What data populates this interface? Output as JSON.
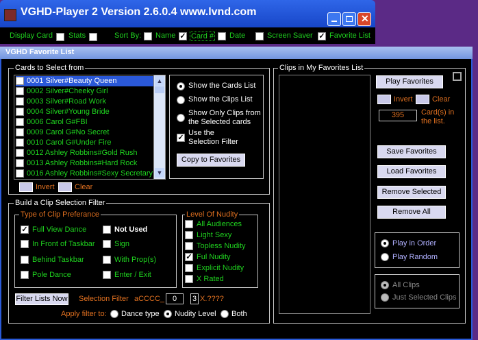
{
  "window": {
    "title": "VGHD-Player 2  Version 2.6.0.4  www.lvnd.com",
    "min_icon": "minimize-icon",
    "max_icon": "maximize-icon",
    "close_icon": "close-icon"
  },
  "toolbar": {
    "display_card": "Display Card",
    "stats": "Stats",
    "sort_by": "Sort By:",
    "name": "Name",
    "card_num": "Card #",
    "date": "Date",
    "screen_saver": "Screen Saver",
    "favorite_list": "Favorite List"
  },
  "fav_window": {
    "title": "VGHD Favorite List"
  },
  "cards": {
    "group_label": "Cards to Select from",
    "items": [
      "0001 Silver#Beauty Queen",
      "0002 Silver#Cheeky Girl",
      "0003 Silver#Road Work",
      "0004 Silver#Young Bride",
      "0006 Carol G#FBI",
      "0009 Carol G#No Secret",
      "0010 Carol G#Under Fire",
      "0012 Ashley Robbins#Gold Rush",
      "0013 Ashley Robbins#Hard Rock",
      "0016 Ashley Robbins#Sexy Secretary"
    ],
    "invert": "Invert",
    "clear": "Clear",
    "options": {
      "show_cards": "Show the Cards List",
      "show_clips": "Show the Clips List",
      "show_only_1": "Show Only Clips from",
      "show_only_2": "the Selected cards",
      "use_filter_1": "Use the",
      "use_filter_2": "Selection Filter"
    },
    "copy_btn": "Copy to Favorites"
  },
  "filter": {
    "group_label": "Build a Clip Selection Filter",
    "type_label": "Type of Clip Preferance",
    "types": {
      "full_view": "Full View Dance",
      "not_used": "Not Used",
      "front_taskbar": "In Front of Taskbar",
      "sign": "Sign",
      "behind_taskbar": "Behind Taskbar",
      "with_props": "With Prop(s)",
      "pole_dance": "Pole Dance",
      "enter_exit": "Enter / Exit"
    },
    "nudity_label": "Level Of Nudity",
    "nudity": {
      "all": "All Audiences",
      "light": "Light Sexy",
      "topless": "Topless Nudity",
      "full": "Ful Nudity",
      "explicit": "Explicit Nudity",
      "xrated": "X Rated"
    },
    "filter_btn": "Filter Lists Now",
    "selection_filter": "Selection Filter",
    "code_prefix": "aCCCC_",
    "code_val1": "0",
    "code_val2": "3",
    "code_suffix": "X.????",
    "apply_to": "Apply filter to:",
    "dance_type": "Dance type",
    "nudity_level": "Nudity Level",
    "both": "Both"
  },
  "clips": {
    "group_label": "Clips in My Favorites List",
    "play_favorites": "Play Favorites",
    "invert": "Invert",
    "clear": "Clear",
    "count": "395",
    "count_label_1": "Card(s) in",
    "count_label_2": "the list.",
    "save": "Save Favorites",
    "load": "Load Favorites",
    "remove_selected": "Remove Selected",
    "remove_all": "Remove All",
    "play_in_order": "Play in Order",
    "play_random": "Play Random",
    "all_clips": "All Clips",
    "just_selected": "Just Selected Clips"
  },
  "colors": {
    "accent_green": "#1fd31f",
    "label_orange": "#e07020",
    "title_blue": "#1746c8"
  }
}
